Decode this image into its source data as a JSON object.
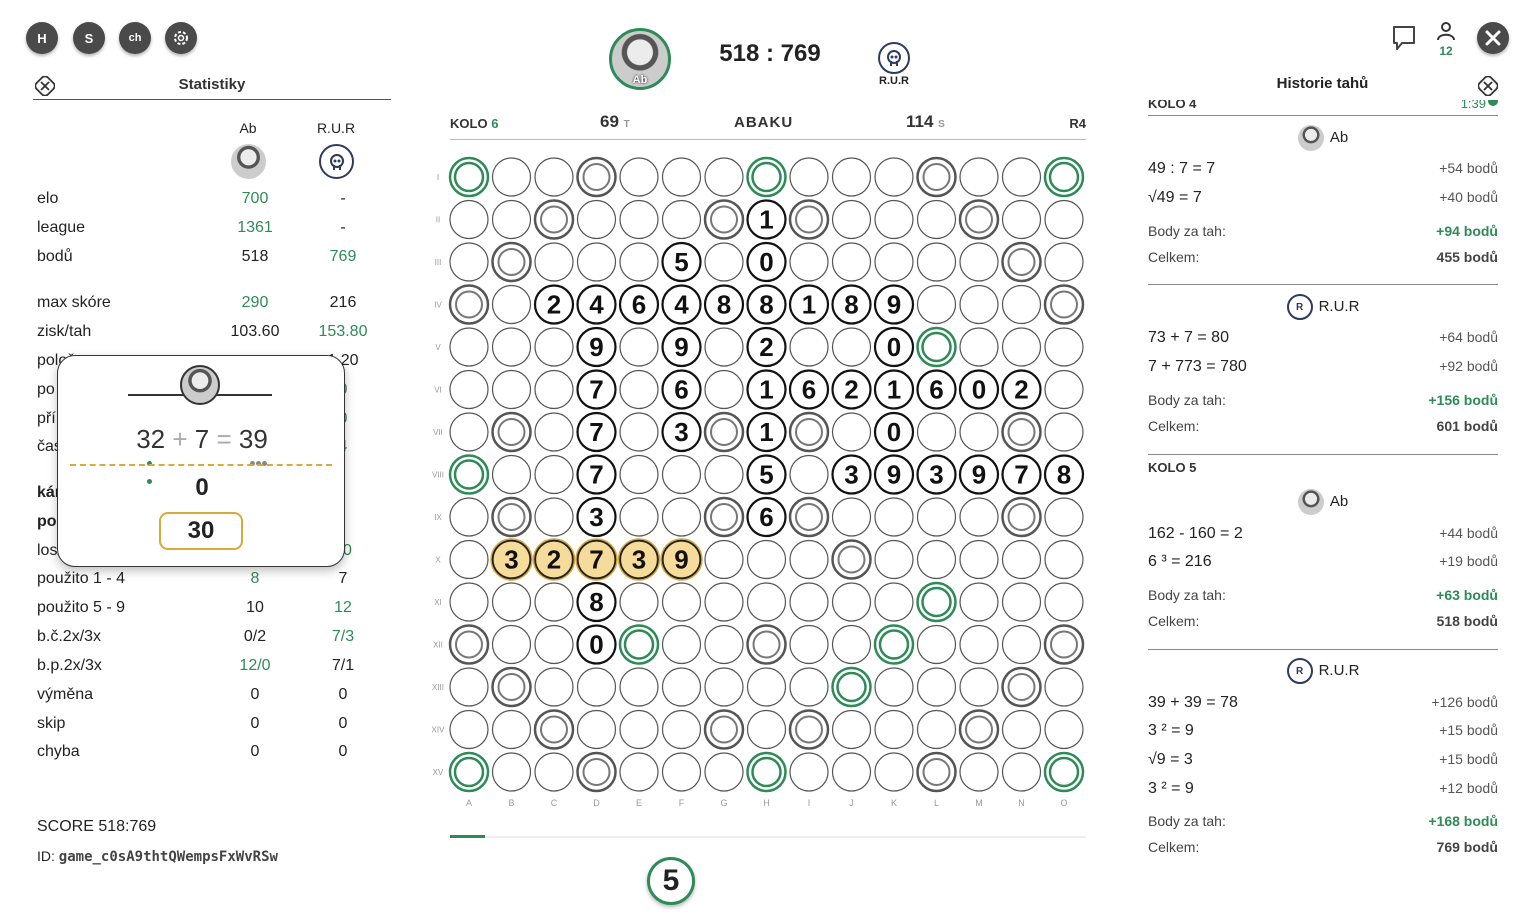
{
  "toolbar": {
    "btn_h": "H",
    "btn_s": "S",
    "btn_ch": "ch",
    "user_count": "12"
  },
  "header": {
    "player1_name": "Ab",
    "player2_name": "R.U.R",
    "score": "518 : 769"
  },
  "stats": {
    "title": "Statistiky",
    "col1": "Ab",
    "col2": "R.U.R",
    "rows": [
      {
        "label": "elo",
        "v1": "700",
        "v2": "-",
        "g1": true,
        "g2": false
      },
      {
        "label": "league",
        "v1": "1361",
        "v2": "-",
        "g1": true,
        "g2": false
      },
      {
        "label": "bodů",
        "v1": "518",
        "v2": "769",
        "g1": false,
        "g2": true
      },
      {
        "label": "max skóre",
        "v1": "290",
        "v2": "216",
        "g1": true,
        "g2": false
      },
      {
        "label": "zisk/tah",
        "v1": "103.60",
        "v2": "153.80",
        "g1": false,
        "g2": true
      },
      {
        "label": "polož",
        "v1": "",
        "v2": "1.20",
        "g1": false,
        "g2": false
      },
      {
        "label": "po",
        "v1": "",
        "v2": "0",
        "g1": false,
        "g2": true
      },
      {
        "label": "pří",
        "v1": "",
        "v2": "0",
        "g1": false,
        "g2": true
      },
      {
        "label": "čas",
        "v1": "",
        "v2": "4",
        "g1": false,
        "g2": true
      },
      {
        "label": "kár",
        "v1": "",
        "v2": "",
        "g1": false,
        "g2": false,
        "bold": true
      },
      {
        "label": "pou",
        "v1": "",
        "v2": "",
        "g1": false,
        "g2": false,
        "bold": true
      },
      {
        "label": "los/",
        "v1": "",
        "v2": "10",
        "g1": false,
        "g2": true
      },
      {
        "label": "použito 1 - 4",
        "v1": "8",
        "v2": "7",
        "g1": true,
        "g2": false
      },
      {
        "label": "použito 5 - 9",
        "v1": "10",
        "v2": "12",
        "g1": false,
        "g2": true
      },
      {
        "label": "b.č.2x/3x",
        "v1": "0/2",
        "v2": "7/3",
        "g1": false,
        "g2": true
      },
      {
        "label": "b.p.2x/3x",
        "v1": "12/0",
        "v2": "7/1",
        "g1": true,
        "g2": false
      },
      {
        "label": "výměna",
        "v1": "0",
        "v2": "0",
        "g1": false,
        "g2": false
      },
      {
        "label": "skip",
        "v1": "0",
        "v2": "0",
        "g1": false,
        "g2": false
      },
      {
        "label": "chyba",
        "v1": "0",
        "v2": "0",
        "g1": false,
        "g2": false
      }
    ],
    "score_line": "SCORE 518:769",
    "id_label": "ID:",
    "id_value": "game_c0sA9thtQWempsFxWvRSw"
  },
  "popup": {
    "eq_a": "32",
    "eq_op": "+",
    "eq_b": "7",
    "eq_eq": "=",
    "eq_c": "39",
    "zero": "0",
    "score": "30"
  },
  "board_header": {
    "kolo": "KOLO",
    "kolo_num": "6",
    "tiles_left": "69",
    "tiles_suffix": "T",
    "logo": "ABAKU",
    "seconds": "114",
    "seconds_suffix": "S",
    "round_code": "R4"
  },
  "board": {
    "rows": [
      "I",
      "II",
      "III",
      "IV",
      "V",
      "VI",
      "VII",
      "VIII",
      "IX",
      "X",
      "XI",
      "XII",
      "XIII",
      "XIV",
      "XV"
    ],
    "cols": [
      "A",
      "B",
      "C",
      "D",
      "E",
      "F",
      "G",
      "H",
      "I",
      "J",
      "K",
      "L",
      "M",
      "N",
      "O"
    ],
    "tiles": [
      {
        "r": 1,
        "c": 7,
        "v": "1"
      },
      {
        "r": 2,
        "c": 5,
        "v": "5"
      },
      {
        "r": 2,
        "c": 7,
        "v": "0"
      },
      {
        "r": 3,
        "c": 2,
        "v": "2"
      },
      {
        "r": 3,
        "c": 3,
        "v": "4"
      },
      {
        "r": 3,
        "c": 4,
        "v": "6"
      },
      {
        "r": 3,
        "c": 5,
        "v": "4"
      },
      {
        "r": 3,
        "c": 6,
        "v": "8"
      },
      {
        "r": 3,
        "c": 7,
        "v": "8"
      },
      {
        "r": 3,
        "c": 8,
        "v": "1"
      },
      {
        "r": 3,
        "c": 9,
        "v": "8"
      },
      {
        "r": 3,
        "c": 10,
        "v": "9"
      },
      {
        "r": 4,
        "c": 3,
        "v": "9"
      },
      {
        "r": 4,
        "c": 5,
        "v": "9"
      },
      {
        "r": 4,
        "c": 7,
        "v": "2"
      },
      {
        "r": 4,
        "c": 10,
        "v": "0"
      },
      {
        "r": 5,
        "c": 3,
        "v": "7"
      },
      {
        "r": 5,
        "c": 5,
        "v": "6"
      },
      {
        "r": 5,
        "c": 7,
        "v": "1"
      },
      {
        "r": 5,
        "c": 8,
        "v": "6"
      },
      {
        "r": 5,
        "c": 9,
        "v": "2"
      },
      {
        "r": 5,
        "c": 10,
        "v": "1"
      },
      {
        "r": 5,
        "c": 11,
        "v": "6"
      },
      {
        "r": 5,
        "c": 12,
        "v": "0"
      },
      {
        "r": 5,
        "c": 13,
        "v": "2"
      },
      {
        "r": 6,
        "c": 3,
        "v": "7"
      },
      {
        "r": 6,
        "c": 5,
        "v": "3"
      },
      {
        "r": 6,
        "c": 7,
        "v": "1"
      },
      {
        "r": 6,
        "c": 10,
        "v": "0"
      },
      {
        "r": 7,
        "c": 3,
        "v": "7"
      },
      {
        "r": 7,
        "c": 7,
        "v": "5"
      },
      {
        "r": 7,
        "c": 9,
        "v": "3"
      },
      {
        "r": 7,
        "c": 10,
        "v": "9"
      },
      {
        "r": 7,
        "c": 11,
        "v": "3"
      },
      {
        "r": 7,
        "c": 12,
        "v": "9"
      },
      {
        "r": 7,
        "c": 13,
        "v": "7"
      },
      {
        "r": 7,
        "c": 14,
        "v": "8"
      },
      {
        "r": 8,
        "c": 3,
        "v": "3"
      },
      {
        "r": 8,
        "c": 7,
        "v": "6"
      },
      {
        "r": 9,
        "c": 1,
        "v": "3",
        "hl": true
      },
      {
        "r": 9,
        "c": 2,
        "v": "2",
        "hl": true
      },
      {
        "r": 9,
        "c": 3,
        "v": "7",
        "hl": true
      },
      {
        "r": 9,
        "c": 4,
        "v": "3",
        "hl": true
      },
      {
        "r": 9,
        "c": 5,
        "v": "9",
        "hl": true
      },
      {
        "r": 10,
        "c": 3,
        "v": "8"
      },
      {
        "r": 11,
        "c": 3,
        "v": "0"
      }
    ],
    "green_bonus": [
      [
        0,
        0
      ],
      [
        0,
        7
      ],
      [
        0,
        14
      ],
      [
        7,
        0
      ],
      [
        14,
        0
      ],
      [
        14,
        7
      ],
      [
        14,
        14
      ],
      [
        4,
        11
      ],
      [
        10,
        11
      ],
      [
        11,
        4
      ],
      [
        11,
        10
      ],
      [
        12,
        9
      ]
    ],
    "grey_bonus": [
      [
        0,
        3
      ],
      [
        0,
        11
      ],
      [
        1,
        2
      ],
      [
        1,
        6
      ],
      [
        1,
        8
      ],
      [
        1,
        12
      ],
      [
        2,
        1
      ],
      [
        2,
        13
      ],
      [
        3,
        0
      ],
      [
        3,
        14
      ],
      [
        6,
        1
      ],
      [
        6,
        6
      ],
      [
        6,
        8
      ],
      [
        6,
        13
      ],
      [
        8,
        1
      ],
      [
        8,
        6
      ],
      [
        8,
        8
      ],
      [
        8,
        13
      ],
      [
        9,
        9
      ],
      [
        11,
        0
      ],
      [
        11,
        7
      ],
      [
        11,
        14
      ],
      [
        12,
        1
      ],
      [
        12,
        13
      ],
      [
        13,
        2
      ],
      [
        13,
        6
      ],
      [
        13,
        8
      ],
      [
        13,
        12
      ],
      [
        14,
        3
      ],
      [
        14,
        11
      ]
    ],
    "bottom_tile": "5"
  },
  "history": {
    "title": "Historie tahů",
    "r4_label": "KOLO 4",
    "r4_time": "1:39",
    "p1": "Ab",
    "p2": "R.U.R",
    "m1": {
      "eq": "49 : 7 = 7",
      "pts": "+54 bodů"
    },
    "m2": {
      "eq": "√49 = 7",
      "pts": "+40 bodů"
    },
    "s1_label": "Body za tah:",
    "s1_val": "+94 bodů",
    "t1_label": "Celkem:",
    "t1_val": "455 bodů",
    "m3": {
      "eq": "73 + 7 = 80",
      "pts": "+64 bodů"
    },
    "m4": {
      "eq": "7 + 773 = 780",
      "pts": "+92 bodů"
    },
    "s2_label": "Body za tah:",
    "s2_val": "+156 bodů",
    "t2_label": "Celkem:",
    "t2_val": "601 bodů",
    "r5_label": "KOLO 5",
    "m5": {
      "eq": "162 - 160 = 2",
      "pts": "+44 bodů"
    },
    "m6": {
      "eq": "6 ³ = 216",
      "pts": "+19 bodů"
    },
    "s3_label": "Body za tah:",
    "s3_val": "+63 bodů",
    "t3_label": "Celkem:",
    "t3_val": "518 bodů",
    "m7": {
      "eq": "39 + 39 = 78",
      "pts": "+126 bodů"
    },
    "m8": {
      "eq": "3 ² = 9",
      "pts": "+15 bodů"
    },
    "m9": {
      "eq": "√9 = 3",
      "pts": "+15 bodů"
    },
    "m10": {
      "eq": "3 ² = 9",
      "pts": "+12 bodů"
    },
    "s4_label": "Body za tah:",
    "s4_val": "+168 bodů",
    "t4_label": "Celkem:",
    "t4_val": "769 bodů"
  },
  "colors": {
    "accent": "#2e8b57",
    "highlight": "#f6dc9b",
    "highlight_border": "#d9a93a"
  }
}
